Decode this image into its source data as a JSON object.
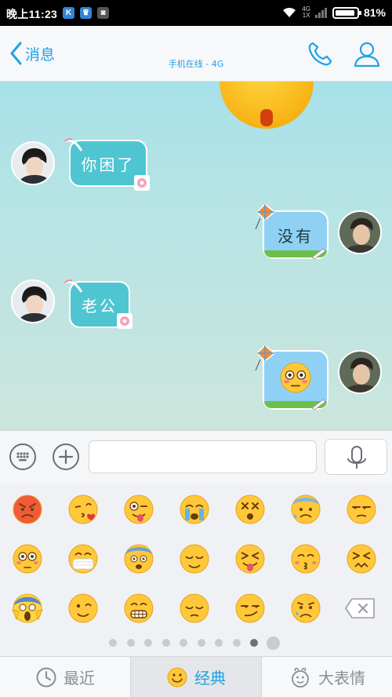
{
  "status": {
    "time": "晚上11:23",
    "net_top": "4G",
    "net_bottom": "1X",
    "battery": "81%",
    "battery_level": 0.81
  },
  "header": {
    "back_label": "消息",
    "subtitle": "手机在线 - 4G"
  },
  "messages": [
    {
      "side": "in",
      "text": "你困了"
    },
    {
      "side": "out",
      "text": "没有"
    },
    {
      "side": "in",
      "text": "老公"
    },
    {
      "side": "out",
      "text": "",
      "emoji": "flushed-emoji"
    }
  ],
  "emoji_grid": [
    [
      "angry",
      "kiss-heart",
      "tongue-wink",
      "crying",
      "dizzy",
      "cold-sweat",
      "unamused"
    ],
    [
      "flushed",
      "mask",
      "fearful",
      "relieved",
      "squint-tongue",
      "kissing",
      "confounded"
    ],
    [
      "scream",
      "wink",
      "grimace",
      "pensive",
      "smirk",
      "disappointed",
      "backspace"
    ]
  ],
  "page_dots": {
    "count": 9,
    "active_index": 8
  },
  "tabs": [
    {
      "label": "最近",
      "icon": "clock-icon",
      "active": false
    },
    {
      "label": "经典",
      "icon": "smiley-icon",
      "active": true
    },
    {
      "label": "大表情",
      "icon": "mascot-icon",
      "active": false
    }
  ],
  "colors": {
    "accent": "#1ea3e6",
    "chat_bg_top": "#a7e1e9",
    "in_bubble": "#4fc5d2",
    "out_bubble": "#8fd1f4"
  }
}
